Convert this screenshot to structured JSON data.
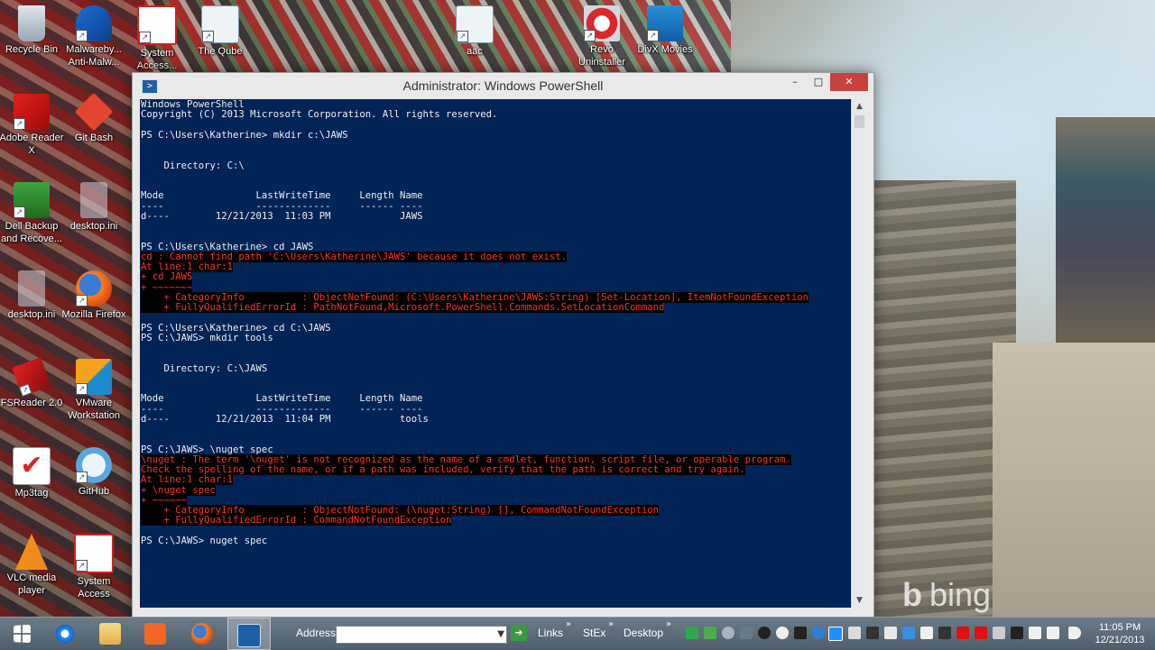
{
  "desktop": {
    "icons": [
      {
        "label": "Recycle Bin"
      },
      {
        "label": "Malwareby... Anti-Malw..."
      },
      {
        "label": "System Access..."
      },
      {
        "label": "The Qube"
      },
      {
        "label": "aac"
      },
      {
        "label": "Revo Uninstaller"
      },
      {
        "label": "DivX Movies"
      },
      {
        "label": "Adobe Reader X"
      },
      {
        "label": "Git Bash"
      },
      {
        "label": "Dell Backup and Recove..."
      },
      {
        "label": "desktop.ini"
      },
      {
        "label": "desktop.ini"
      },
      {
        "label": "Mozilla Firefox"
      },
      {
        "label": "FSReader 2.0"
      },
      {
        "label": "VMware Workstation"
      },
      {
        "label": "Mp3tag"
      },
      {
        "label": "GitHub"
      },
      {
        "label": "VLC media player"
      },
      {
        "label": "System Access"
      }
    ]
  },
  "window": {
    "title": "Administrator: Windows PowerShell",
    "minimize_glyph": "–",
    "maximize_glyph": "□",
    "close_glyph": "✕",
    "console_lines": [
      {
        "text": "Windows PowerShell",
        "error": false
      },
      {
        "text": "Copyright (C) 2013 Microsoft Corporation. All rights reserved.",
        "error": false
      },
      {
        "text": "",
        "error": false
      },
      {
        "text": "PS C:\\Users\\Katherine> mkdir c:\\JAWS",
        "error": false
      },
      {
        "text": "",
        "error": false
      },
      {
        "text": "",
        "error": false
      },
      {
        "text": "    Directory: C:\\",
        "error": false
      },
      {
        "text": "",
        "error": false
      },
      {
        "text": "",
        "error": false
      },
      {
        "text": "Mode                LastWriteTime     Length Name",
        "error": false
      },
      {
        "text": "----                -------------     ------ ----",
        "error": false
      },
      {
        "text": "d----        12/21/2013  11:03 PM            JAWS",
        "error": false
      },
      {
        "text": "",
        "error": false
      },
      {
        "text": "",
        "error": false
      },
      {
        "text": "PS C:\\Users\\Katherine> cd JAWS",
        "error": false
      },
      {
        "text": "cd : Cannot find path 'C:\\Users\\Katherine\\JAWS' because it does not exist.",
        "error": true
      },
      {
        "text": "At line:1 char:1",
        "error": true
      },
      {
        "text": "+ cd JAWS",
        "error": true
      },
      {
        "text": "+ ~~~~~~~",
        "error": true
      },
      {
        "text": "    + CategoryInfo          : ObjectNotFound: (C:\\Users\\Katherine\\JAWS:String) [Set-Location], ItemNotFoundException",
        "error": true
      },
      {
        "text": "    + FullyQualifiedErrorId : PathNotFound,Microsoft.PowerShell.Commands.SetLocationCommand",
        "error": true
      },
      {
        "text": "",
        "error": false
      },
      {
        "text": "PS C:\\Users\\Katherine> cd C:\\JAWS",
        "error": false
      },
      {
        "text": "PS C:\\JAWS> mkdir tools",
        "error": false
      },
      {
        "text": "",
        "error": false
      },
      {
        "text": "",
        "error": false
      },
      {
        "text": "    Directory: C:\\JAWS",
        "error": false
      },
      {
        "text": "",
        "error": false
      },
      {
        "text": "",
        "error": false
      },
      {
        "text": "Mode                LastWriteTime     Length Name",
        "error": false
      },
      {
        "text": "----                -------------     ------ ----",
        "error": false
      },
      {
        "text": "d----        12/21/2013  11:04 PM            tools",
        "error": false
      },
      {
        "text": "",
        "error": false
      },
      {
        "text": "",
        "error": false
      },
      {
        "text": "PS C:\\JAWS> \\nuget spec",
        "error": false
      },
      {
        "text": "\\nuget : The term '\\nuget' is not recognized as the name of a cmdlet, function, script file, or operable program.",
        "error": true
      },
      {
        "text": "Check the spelling of the name, or if a path was included, verify that the path is correct and try again.",
        "error": true
      },
      {
        "text": "At line:1 char:1",
        "error": true
      },
      {
        "text": "+ \\nuget spec",
        "error": true
      },
      {
        "text": "+ ~~~~~~",
        "error": true
      },
      {
        "text": "    + CategoryInfo          : ObjectNotFound: (\\nuget:String) [], CommandNotFoundException",
        "error": true
      },
      {
        "text": "    + FullyQualifiedErrorId : CommandNotFoundException",
        "error": true
      },
      {
        "text": "",
        "error": false
      },
      {
        "text": "PS C:\\JAWS> nuget spec",
        "error": false
      }
    ]
  },
  "watermark": {
    "text": "bing"
  },
  "taskbar": {
    "address_label": "Address",
    "address_value": "",
    "toolbars": [
      "Links",
      "StEx",
      "Desktop"
    ],
    "clock_time": "11:05 PM",
    "clock_date": "12/21/2013"
  },
  "colors": {
    "console_bg": "#012456",
    "console_fg": "#eeedf0",
    "error_fg": "#ff3030",
    "close_button": "#c7413f"
  }
}
